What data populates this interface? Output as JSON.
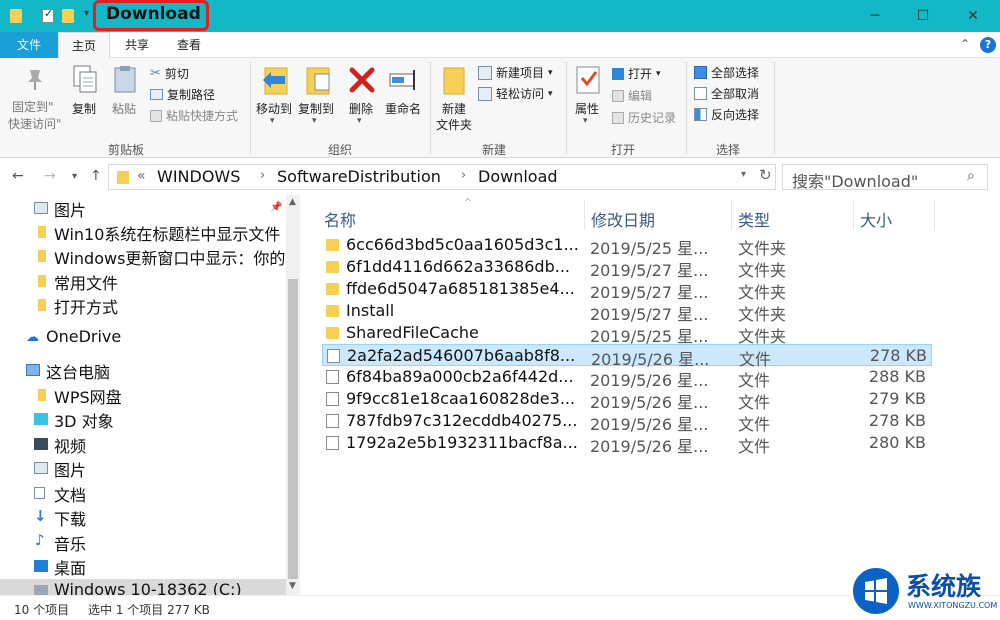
{
  "window": {
    "title": "Download",
    "highlight_color": "#e32020",
    "titlebar_color": "#12b8c6"
  },
  "tabs": {
    "file": "文件",
    "home": "主页",
    "share": "共享",
    "view": "查看"
  },
  "ribbon": {
    "clipboard": {
      "group": "剪贴板",
      "pin": "固定到\"",
      "pin2": "快速访问\"",
      "copy": "复制",
      "paste": "粘贴",
      "cut": "剪切",
      "copy_path": "复制路径",
      "paste_shortcut": "粘贴快捷方式"
    },
    "organize": {
      "group": "组织",
      "move_to": "移动到",
      "copy_to": "复制到",
      "delete": "删除",
      "rename": "重命名"
    },
    "new": {
      "group": "新建",
      "new_folder": "新建",
      "new_folder2": "文件夹",
      "new_item": "新建项目",
      "easy_access": "轻松访问"
    },
    "open": {
      "group": "打开",
      "properties": "属性",
      "open": "打开",
      "edit": "编辑",
      "history": "历史记录"
    },
    "select": {
      "group": "选择",
      "select_all": "全部选择",
      "select_none": "全部取消",
      "invert": "反向选择"
    }
  },
  "address": {
    "prefix": "«",
    "crumbs": [
      "WINDOWS",
      "SoftwareDistribution",
      "Download"
    ],
    "search_placeholder": "搜索\"Download\""
  },
  "navpane": {
    "items": [
      {
        "label": "图片",
        "icon": "pictures-icon"
      },
      {
        "label": "Win10系统在标题栏中显示文件",
        "icon": "folder-icon"
      },
      {
        "label": "Windows更新窗口中显示：你的",
        "icon": "folder-icon"
      },
      {
        "label": "常用文件",
        "icon": "folder-icon"
      },
      {
        "label": "打开方式",
        "icon": "folder-icon"
      },
      {
        "label": "OneDrive",
        "icon": "cloud-icon"
      },
      {
        "label": "这台电脑",
        "icon": "computer-icon"
      },
      {
        "label": "WPS网盘",
        "icon": "folder-icon"
      },
      {
        "label": "3D 对象",
        "icon": "cube-icon"
      },
      {
        "label": "视频",
        "icon": "video-icon"
      },
      {
        "label": "图片",
        "icon": "pictures-icon"
      },
      {
        "label": "文档",
        "icon": "document-icon"
      },
      {
        "label": "下载",
        "icon": "download-icon"
      },
      {
        "label": "音乐",
        "icon": "music-icon"
      },
      {
        "label": "桌面",
        "icon": "desktop-icon"
      },
      {
        "label": "Windows 10-18362 (C:)",
        "icon": "drive-icon"
      }
    ]
  },
  "columns": {
    "name": "名称",
    "date": "修改日期",
    "type": "类型",
    "size": "大小"
  },
  "files": [
    {
      "name": "6cc66d3bd5c0aa1605d3c1...",
      "date": "2019/5/25 星...",
      "type": "文件夹",
      "size": "",
      "kind": "folder"
    },
    {
      "name": "6f1dd4116d662a33686db...",
      "date": "2019/5/27 星...",
      "type": "文件夹",
      "size": "",
      "kind": "folder"
    },
    {
      "name": "ffde6d5047a685181385e4...",
      "date": "2019/5/27 星...",
      "type": "文件夹",
      "size": "",
      "kind": "folder"
    },
    {
      "name": "Install",
      "date": "2019/5/27 星...",
      "type": "文件夹",
      "size": "",
      "kind": "folder"
    },
    {
      "name": "SharedFileCache",
      "date": "2019/5/25 星...",
      "type": "文件夹",
      "size": "",
      "kind": "folder"
    },
    {
      "name": "2a2fa2ad546007b6aab8f8...",
      "date": "2019/5/26 星...",
      "type": "文件",
      "size": "278 KB",
      "kind": "file"
    },
    {
      "name": "6f84ba89a000cb2a6f442d...",
      "date": "2019/5/26 星...",
      "type": "文件",
      "size": "288 KB",
      "kind": "file"
    },
    {
      "name": "9f9cc81e18caa160828de3...",
      "date": "2019/5/26 星...",
      "type": "文件",
      "size": "279 KB",
      "kind": "file"
    },
    {
      "name": "787fdb97c312ecddb40275...",
      "date": "2019/5/26 星...",
      "type": "文件",
      "size": "278 KB",
      "kind": "file"
    },
    {
      "name": "1792a2e5b1932311bacf8a...",
      "date": "2019/5/26 星...",
      "type": "文件",
      "size": "280 KB",
      "kind": "file"
    }
  ],
  "status": {
    "count": "10 个项目",
    "selected": "选中 1 个项目  277 KB"
  },
  "watermark": {
    "text": "系统族",
    "url": "WWW.XITONGZU.COM"
  }
}
